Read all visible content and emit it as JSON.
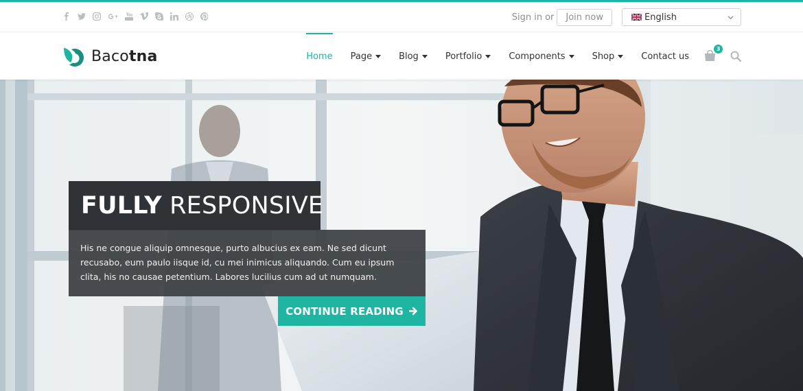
{
  "colors": {
    "accent": "#1fb5a3",
    "dark": "#2f3338"
  },
  "topbar": {
    "social_icons": [
      "facebook-icon",
      "twitter-icon",
      "instagram-icon",
      "google-plus-icon",
      "youtube-icon",
      "vimeo-icon",
      "skype-icon",
      "linkedin-icon",
      "dribbble-icon",
      "pinterest-icon"
    ],
    "sign_in": "Sign in",
    "or": "or",
    "join_now": "Join now",
    "language": "English"
  },
  "header": {
    "logo": {
      "light": "Baco",
      "bold": "tna"
    },
    "nav": [
      {
        "label": "Home"
      },
      {
        "label": "Page"
      },
      {
        "label": "Blog"
      },
      {
        "label": "Portfolio"
      },
      {
        "label": "Components"
      },
      {
        "label": "Shop"
      },
      {
        "label": "Contact us"
      }
    ],
    "cart_count": "3"
  },
  "hero": {
    "title_bold": "FULLY",
    "title_rest": " RESPONSIVE",
    "description": "His ne congue aliquip omnesque, purto albucius ex eam. Ne sed dicunt recusabo, eum paulo iisque id, cu mei inimicus aliquando. Cum eu ipsum clita, his no causae petentium. Labores lucilius cum ad ut numquam.",
    "cta": "CONTINUE READING"
  }
}
